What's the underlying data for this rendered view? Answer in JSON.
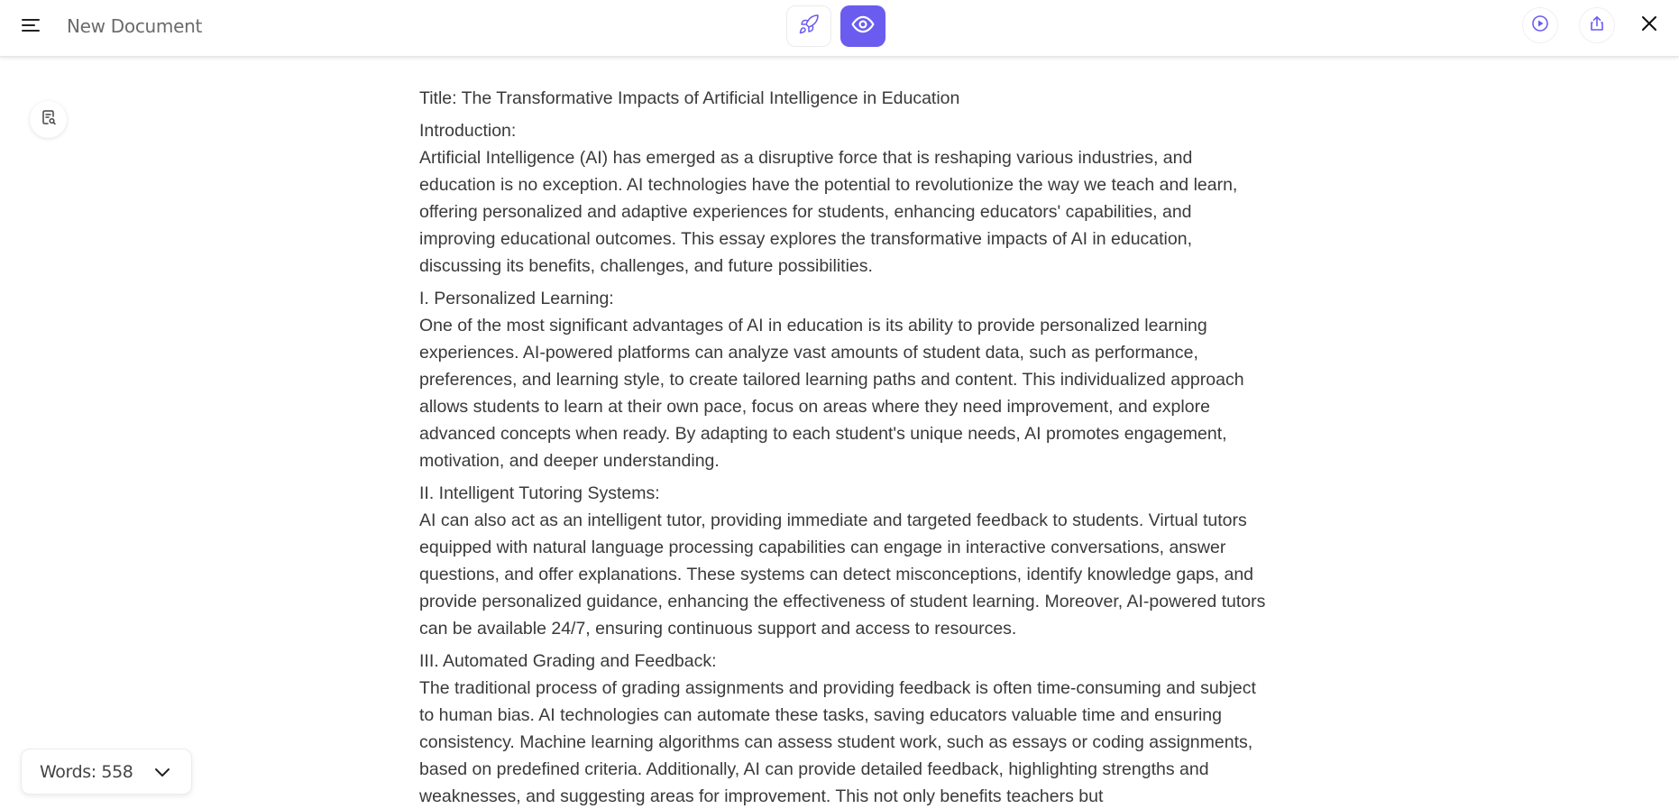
{
  "header": {
    "menu_icon": "hamburger-menu-icon",
    "title": "New Document",
    "center_tools": [
      {
        "name": "rocket",
        "icon": "rocket-icon",
        "active": false
      },
      {
        "name": "preview",
        "icon": "eye-icon",
        "active": true
      }
    ],
    "right_tools": [
      {
        "name": "play",
        "icon": "play-circle-icon"
      },
      {
        "name": "share",
        "icon": "share-upload-icon"
      },
      {
        "name": "close",
        "icon": "close-icon"
      }
    ]
  },
  "colors": {
    "accent": "#6b5cf0",
    "text": "#3a3a3a",
    "title_text": "#6b6b6b"
  },
  "sidebar": {
    "search_doc_icon": "document-search-icon"
  },
  "document": {
    "title": "Title: The Transformative Impacts of Artificial Intelligence in Education",
    "sections": [
      {
        "heading": "Introduction:",
        "body": "Artificial Intelligence (AI) has emerged as a disruptive force that is reshaping various industries, and education is no exception. AI technologies have the potential to revolutionize the way we teach and learn, offering personalized and adaptive experiences for students, enhancing educators' capabilities, and improving educational outcomes. This essay explores the transformative impacts of AI in education, discussing its benefits, challenges, and future possibilities."
      },
      {
        "heading": "I. Personalized Learning:",
        "body": "One of the most significant advantages of AI in education is its ability to provide personalized learning experiences. AI-powered platforms can analyze vast amounts of student data, such as performance, preferences, and learning style, to create tailored learning paths and content. This individualized approach allows students to learn at their own pace, focus on areas where they need improvement, and explore advanced concepts when ready. By adapting to each student's unique needs, AI promotes engagement, motivation, and deeper understanding."
      },
      {
        "heading": "II. Intelligent Tutoring Systems:",
        "body": "AI can also act as an intelligent tutor, providing immediate and targeted feedback to students. Virtual tutors equipped with natural language processing capabilities can engage in interactive conversations, answer questions, and offer explanations. These systems can detect misconceptions, identify knowledge gaps, and provide personalized guidance, enhancing the effectiveness of student learning. Moreover, AI-powered tutors can be available 24/7, ensuring continuous support and access to resources."
      },
      {
        "heading": "III. Automated Grading and Feedback:",
        "body": "The traditional process of grading assignments and providing feedback is often time-consuming and subject to human bias. AI technologies can automate these tasks, saving educators valuable time and ensuring consistency. Machine learning algorithms can assess student work, such as essays or coding assignments, based on predefined criteria. Additionally, AI can provide detailed feedback, highlighting strengths and weaknesses, and suggesting areas for improvement. This not only benefits teachers but"
      }
    ]
  },
  "word_count": {
    "label": "Words: 558",
    "chevron_icon": "chevron-down-icon"
  }
}
